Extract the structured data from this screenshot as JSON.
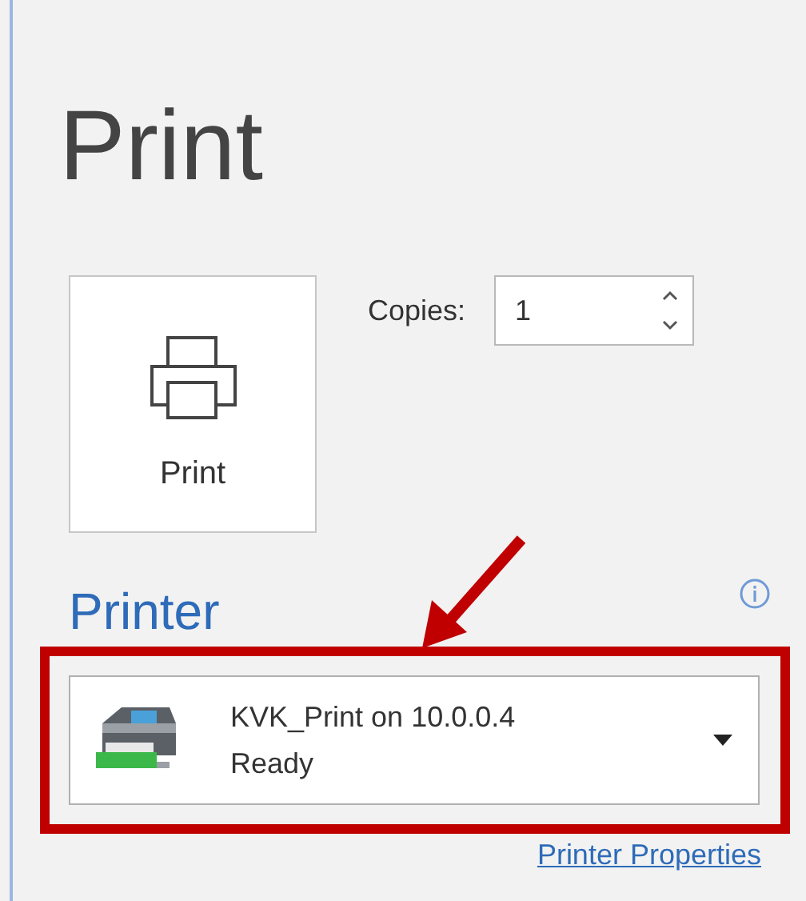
{
  "title": "Print",
  "print_button": {
    "label": "Print"
  },
  "copies": {
    "label": "Copies:",
    "value": "1"
  },
  "printer": {
    "heading": "Printer",
    "name": "KVK_Print on 10.0.0.4",
    "status": "Ready",
    "highlighted": true
  },
  "printer_properties_link": "Printer Properties"
}
